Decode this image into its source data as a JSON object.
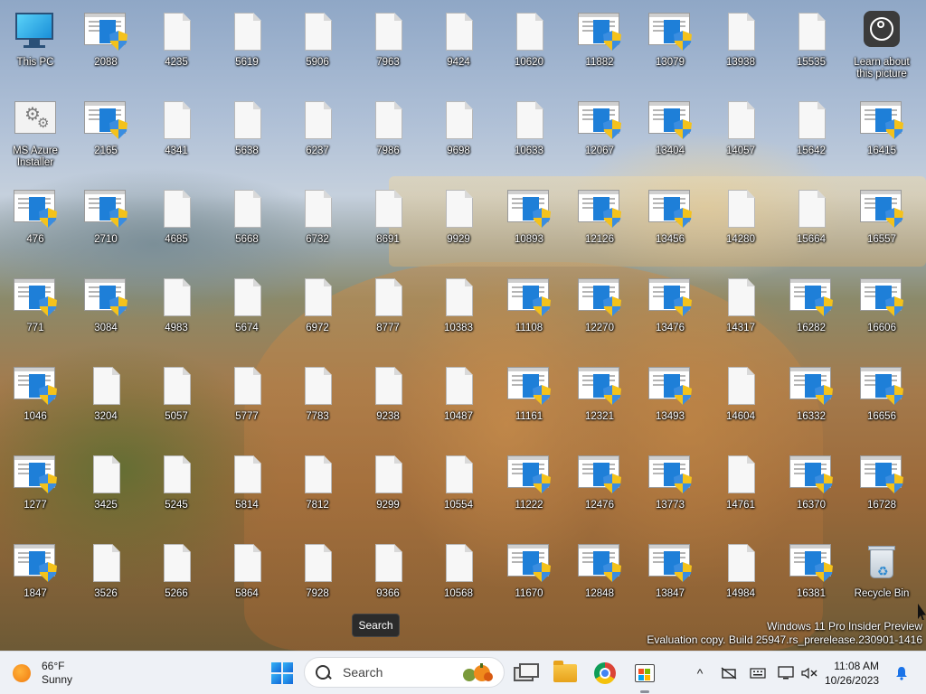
{
  "desktop": {
    "icons": [
      {
        "label": "This PC",
        "kind": "pc",
        "col": 0,
        "row": 0
      },
      {
        "label": "2088",
        "kind": "installer",
        "col": 1,
        "row": 0
      },
      {
        "label": "4235",
        "kind": "doc",
        "col": 2,
        "row": 0
      },
      {
        "label": "5619",
        "kind": "doc",
        "col": 3,
        "row": 0
      },
      {
        "label": "5906",
        "kind": "doc",
        "col": 4,
        "row": 0
      },
      {
        "label": "7963",
        "kind": "doc",
        "col": 5,
        "row": 0
      },
      {
        "label": "9424",
        "kind": "doc",
        "col": 6,
        "row": 0
      },
      {
        "label": "10620",
        "kind": "doc",
        "col": 7,
        "row": 0
      },
      {
        "label": "11882",
        "kind": "installer",
        "col": 8,
        "row": 0
      },
      {
        "label": "13079",
        "kind": "installer",
        "col": 9,
        "row": 0
      },
      {
        "label": "13938",
        "kind": "doc",
        "col": 10,
        "row": 0
      },
      {
        "label": "15535",
        "kind": "doc",
        "col": 11,
        "row": 0
      },
      {
        "label": "Learn about this picture",
        "kind": "learn",
        "col": 12,
        "row": 0
      },
      {
        "label": "MS Azure Installer",
        "kind": "gear",
        "col": 0,
        "row": 1
      },
      {
        "label": "2165",
        "kind": "installer",
        "col": 1,
        "row": 1
      },
      {
        "label": "4341",
        "kind": "doc",
        "col": 2,
        "row": 1
      },
      {
        "label": "5638",
        "kind": "doc",
        "col": 3,
        "row": 1
      },
      {
        "label": "6237",
        "kind": "doc",
        "col": 4,
        "row": 1
      },
      {
        "label": "7986",
        "kind": "doc",
        "col": 5,
        "row": 1
      },
      {
        "label": "9698",
        "kind": "doc",
        "col": 6,
        "row": 1
      },
      {
        "label": "10633",
        "kind": "doc",
        "col": 7,
        "row": 1
      },
      {
        "label": "12067",
        "kind": "installer",
        "col": 8,
        "row": 1
      },
      {
        "label": "13404",
        "kind": "installer",
        "col": 9,
        "row": 1
      },
      {
        "label": "14057",
        "kind": "doc",
        "col": 10,
        "row": 1
      },
      {
        "label": "15642",
        "kind": "doc",
        "col": 11,
        "row": 1
      },
      {
        "label": "16415",
        "kind": "installer",
        "col": 12,
        "row": 1
      },
      {
        "label": "476",
        "kind": "installer",
        "col": 0,
        "row": 2
      },
      {
        "label": "2710",
        "kind": "installer",
        "col": 1,
        "row": 2
      },
      {
        "label": "4685",
        "kind": "doc",
        "col": 2,
        "row": 2
      },
      {
        "label": "5668",
        "kind": "doc",
        "col": 3,
        "row": 2
      },
      {
        "label": "6732",
        "kind": "doc",
        "col": 4,
        "row": 2
      },
      {
        "label": "8691",
        "kind": "doc",
        "col": 5,
        "row": 2
      },
      {
        "label": "9929",
        "kind": "doc",
        "col": 6,
        "row": 2
      },
      {
        "label": "10893",
        "kind": "installer",
        "col": 7,
        "row": 2
      },
      {
        "label": "12126",
        "kind": "installer",
        "col": 8,
        "row": 2
      },
      {
        "label": "13456",
        "kind": "installer",
        "col": 9,
        "row": 2
      },
      {
        "label": "14280",
        "kind": "doc",
        "col": 10,
        "row": 2
      },
      {
        "label": "15664",
        "kind": "doc",
        "col": 11,
        "row": 2
      },
      {
        "label": "16557",
        "kind": "installer",
        "col": 12,
        "row": 2
      },
      {
        "label": "771",
        "kind": "installer",
        "col": 0,
        "row": 3
      },
      {
        "label": "3084",
        "kind": "installer",
        "col": 1,
        "row": 3
      },
      {
        "label": "4983",
        "kind": "doc",
        "col": 2,
        "row": 3
      },
      {
        "label": "5674",
        "kind": "doc",
        "col": 3,
        "row": 3
      },
      {
        "label": "6972",
        "kind": "doc",
        "col": 4,
        "row": 3
      },
      {
        "label": "8777",
        "kind": "doc",
        "col": 5,
        "row": 3
      },
      {
        "label": "10383",
        "kind": "doc",
        "col": 6,
        "row": 3
      },
      {
        "label": "11108",
        "kind": "installer",
        "col": 7,
        "row": 3
      },
      {
        "label": "12270",
        "kind": "installer",
        "col": 8,
        "row": 3
      },
      {
        "label": "13476",
        "kind": "installer",
        "col": 9,
        "row": 3
      },
      {
        "label": "14317",
        "kind": "doc",
        "col": 10,
        "row": 3
      },
      {
        "label": "16282",
        "kind": "installer",
        "col": 11,
        "row": 3
      },
      {
        "label": "16606",
        "kind": "installer",
        "col": 12,
        "row": 3
      },
      {
        "label": "1046",
        "kind": "installer",
        "col": 0,
        "row": 4
      },
      {
        "label": "3204",
        "kind": "doc",
        "col": 1,
        "row": 4
      },
      {
        "label": "5057",
        "kind": "doc",
        "col": 2,
        "row": 4
      },
      {
        "label": "5777",
        "kind": "doc",
        "col": 3,
        "row": 4
      },
      {
        "label": "7783",
        "kind": "doc",
        "col": 4,
        "row": 4
      },
      {
        "label": "9238",
        "kind": "doc",
        "col": 5,
        "row": 4
      },
      {
        "label": "10487",
        "kind": "doc",
        "col": 6,
        "row": 4
      },
      {
        "label": "11161",
        "kind": "installer",
        "col": 7,
        "row": 4
      },
      {
        "label": "12321",
        "kind": "installer",
        "col": 8,
        "row": 4
      },
      {
        "label": "13493",
        "kind": "installer",
        "col": 9,
        "row": 4
      },
      {
        "label": "14604",
        "kind": "doc",
        "col": 10,
        "row": 4
      },
      {
        "label": "16332",
        "kind": "installer",
        "col": 11,
        "row": 4
      },
      {
        "label": "16656",
        "kind": "installer",
        "col": 12,
        "row": 4
      },
      {
        "label": "1277",
        "kind": "installer",
        "col": 0,
        "row": 5
      },
      {
        "label": "3425",
        "kind": "doc",
        "col": 1,
        "row": 5
      },
      {
        "label": "5245",
        "kind": "doc",
        "col": 2,
        "row": 5
      },
      {
        "label": "5814",
        "kind": "doc",
        "col": 3,
        "row": 5
      },
      {
        "label": "7812",
        "kind": "doc",
        "col": 4,
        "row": 5
      },
      {
        "label": "9299",
        "kind": "doc",
        "col": 5,
        "row": 5
      },
      {
        "label": "10554",
        "kind": "doc",
        "col": 6,
        "row": 5
      },
      {
        "label": "11222",
        "kind": "installer",
        "col": 7,
        "row": 5
      },
      {
        "label": "12476",
        "kind": "installer",
        "col": 8,
        "row": 5
      },
      {
        "label": "13773",
        "kind": "installer",
        "col": 9,
        "row": 5
      },
      {
        "label": "14761",
        "kind": "doc",
        "col": 10,
        "row": 5
      },
      {
        "label": "16370",
        "kind": "installer",
        "col": 11,
        "row": 5
      },
      {
        "label": "16728",
        "kind": "installer",
        "col": 12,
        "row": 5
      },
      {
        "label": "1847",
        "kind": "installer",
        "col": 0,
        "row": 6
      },
      {
        "label": "3526",
        "kind": "doc",
        "col": 1,
        "row": 6
      },
      {
        "label": "5266",
        "kind": "doc",
        "col": 2,
        "row": 6
      },
      {
        "label": "5864",
        "kind": "doc",
        "col": 3,
        "row": 6
      },
      {
        "label": "7928",
        "kind": "doc",
        "col": 4,
        "row": 6
      },
      {
        "label": "9366",
        "kind": "doc",
        "col": 5,
        "row": 6
      },
      {
        "label": "10568",
        "kind": "doc",
        "col": 6,
        "row": 6
      },
      {
        "label": "11670",
        "kind": "installer",
        "col": 7,
        "row": 6
      },
      {
        "label": "12848",
        "kind": "installer",
        "col": 8,
        "row": 6
      },
      {
        "label": "13847",
        "kind": "installer",
        "col": 9,
        "row": 6
      },
      {
        "label": "14984",
        "kind": "doc",
        "col": 10,
        "row": 6
      },
      {
        "label": "16381",
        "kind": "installer",
        "col": 11,
        "row": 6
      },
      {
        "label": "Recycle Bin",
        "kind": "bin",
        "col": 12,
        "row": 6
      }
    ]
  },
  "tooltip": {
    "text": "Search"
  },
  "watermark": {
    "line1": "Windows 11 Pro Insider Preview",
    "line2": "Evaluation copy. Build 25947.rs_prerelease.230901-1416"
  },
  "taskbar": {
    "weather": {
      "temp": "66°F",
      "condition": "Sunny",
      "icon": "sun-icon"
    },
    "start_icon": "windows-logo-icon",
    "search": {
      "placeholder": "Search"
    },
    "apps": [
      {
        "name": "task-view",
        "icon": "task-view-icon"
      },
      {
        "name": "file-explorer",
        "icon": "folder-icon"
      },
      {
        "name": "chrome",
        "icon": "chrome-icon"
      },
      {
        "name": "microsoft-store",
        "icon": "store-icon"
      }
    ],
    "tray": {
      "chevron": "^",
      "icons": [
        "network-icon",
        "keyboard-icon",
        "display-icon",
        "volume-muted-icon"
      ]
    },
    "clock": {
      "time": "11:08 AM",
      "date": "10/26/2023"
    },
    "notification_icon": "bell-icon"
  },
  "colors": {
    "taskbar_bg": "#eef1f6",
    "accent": "#1e7fd8",
    "shield_yellow": "#f4c21b"
  }
}
